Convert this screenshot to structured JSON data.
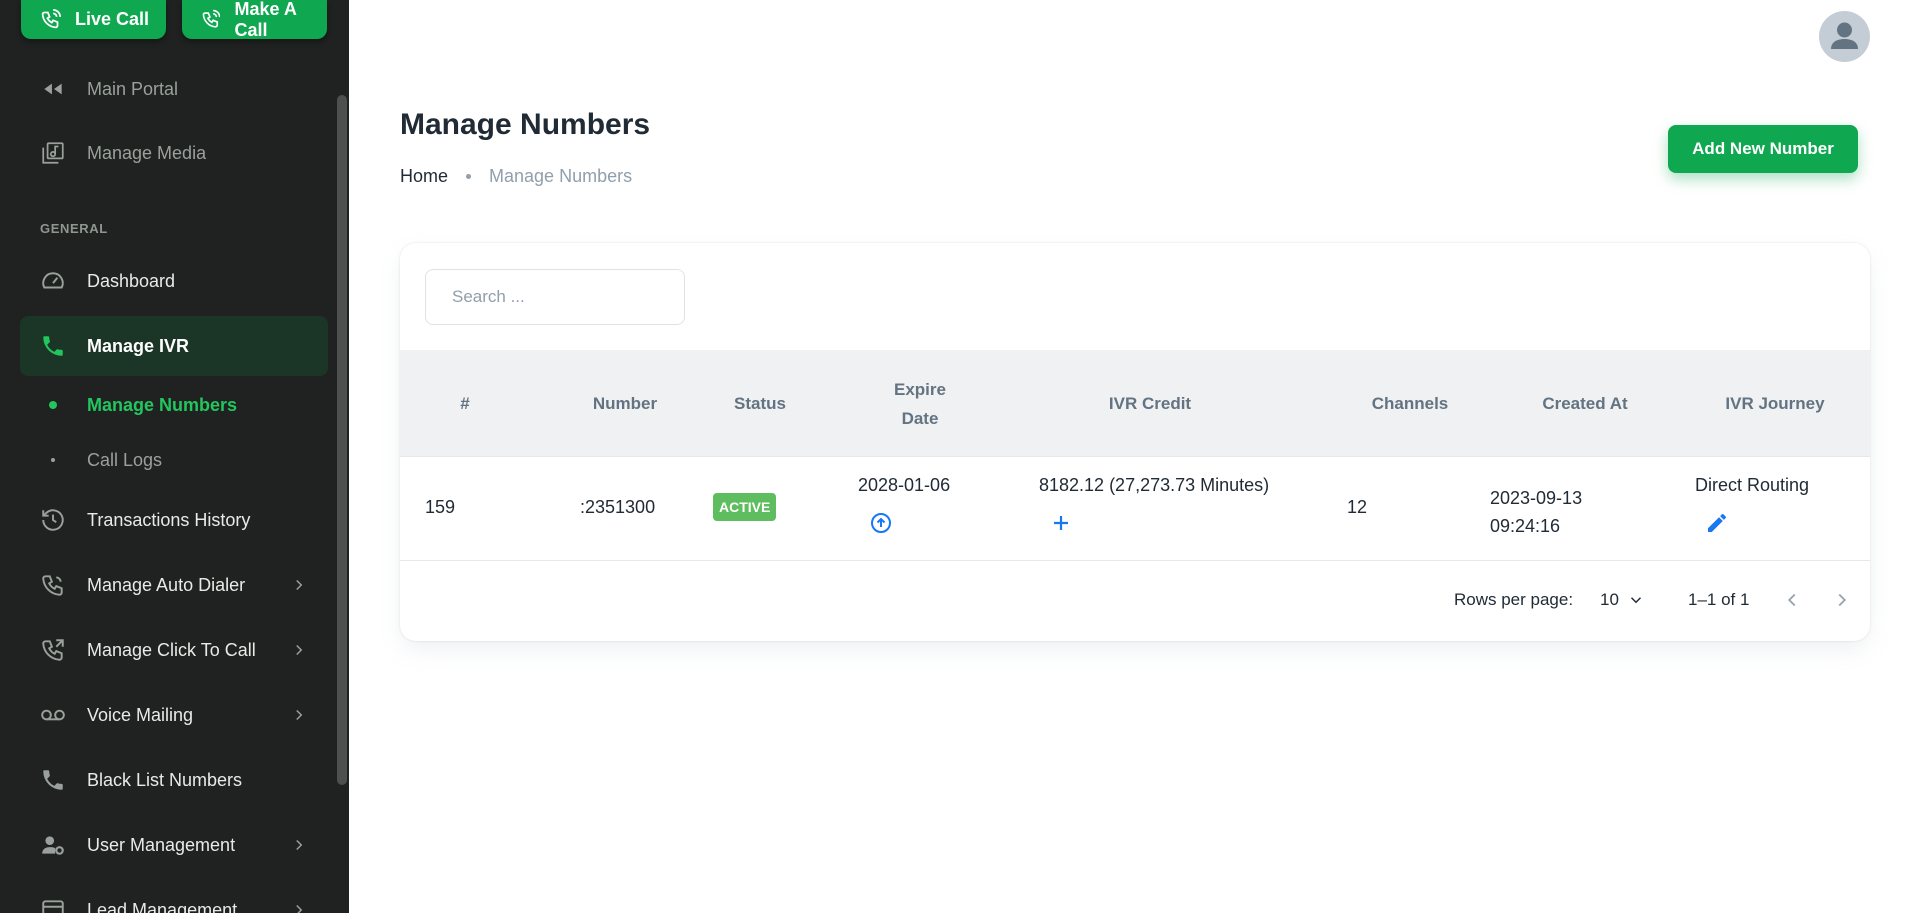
{
  "top_buttons": {
    "live_call": "Live Call",
    "make_call": "Make A Call"
  },
  "sidebar": {
    "main_portal": "Main Portal",
    "manage_media": "Manage Media",
    "section_general": "GENERAL",
    "items": [
      {
        "label": "Dashboard",
        "icon": "dashboard-icon"
      },
      {
        "label": "Manage IVR",
        "icon": "phone-icon"
      },
      {
        "label": "Transactions History",
        "icon": "history-icon"
      },
      {
        "label": "Manage Auto Dialer",
        "icon": "auto-dialer-icon"
      },
      {
        "label": "Manage Click To Call",
        "icon": "click-to-call-icon"
      },
      {
        "label": "Voice Mailing",
        "icon": "voicemail-icon"
      },
      {
        "label": "Black List Numbers",
        "icon": "phone-icon"
      },
      {
        "label": "User Management",
        "icon": "user-gear-icon"
      },
      {
        "label": "Lead Management",
        "icon": "lead-icon"
      }
    ],
    "sub_items": [
      {
        "label": "Manage Numbers"
      },
      {
        "label": "Call Logs"
      }
    ]
  },
  "page": {
    "title": "Manage Numbers",
    "breadcrumb_home": "Home",
    "breadcrumb_current": "Manage Numbers",
    "add_button": "Add New Number"
  },
  "search": {
    "placeholder": "Search ..."
  },
  "table": {
    "headers": {
      "id": "#",
      "number": "Number",
      "status": "Status",
      "expire_1": "Expire",
      "expire_2": "Date",
      "ivr_credit": "IVR Credit",
      "channels": "Channels",
      "created_at": "Created At",
      "ivr_journey": "IVR Journey"
    },
    "rows": [
      {
        "id": "159",
        "number": ":2351300",
        "status": "ACTIVE",
        "expire_date": "2028-01-06",
        "ivr_credit": "8182.12 (27,273.73 Minutes)",
        "channels": "12",
        "created_date": "2023-09-13",
        "created_time": "09:24:16",
        "ivr_journey": "Direct Routing"
      }
    ]
  },
  "pagination": {
    "rows_per_page_label": "Rows per page:",
    "rows_per_page": "10",
    "range": "1–1 of 1"
  },
  "colors": {
    "brand_green": "#0fa74f",
    "active_green": "#22c55e",
    "sidebar_bg": "#1f2220",
    "link_blue": "#1877f2"
  }
}
